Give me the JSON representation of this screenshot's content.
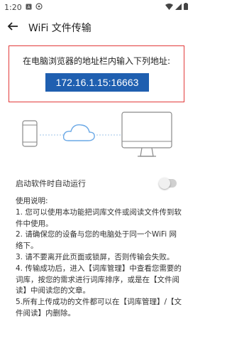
{
  "status_bar": {
    "time": "1:20",
    "left_icons": [
      "sim-a-icon",
      "nfc-icon"
    ],
    "right_icons": [
      "wifi-icon",
      "signal-icon",
      "battery-icon"
    ]
  },
  "app_bar": {
    "title": "WiFi 文件传输"
  },
  "address_panel": {
    "hint": "在电脑浏览器的地址栏内输入下列地址:",
    "address": "172.16.1.15:16663",
    "accent_color": "#e23b3b",
    "highlight_color": "#1f5fb0"
  },
  "settings": {
    "autorun_label": "启动软件时自动运行",
    "autorun_enabled": false
  },
  "instructions": {
    "heading": "使用说明:",
    "items": [
      "1. 您可以使用本功能把词库文件或阅读文件传到软件中使用。",
      "2. 请确保您的设备与您的电脑处于同一个WiFi 网络下。",
      "3. 请不要离开此页面或锁屏，否则传输会失败。",
      "4. 传输成功后，进入【词库管理】中查看您需要的词库，按您的需求进行词库排序，或是在【文件阅读】中阅读您的文章。",
      "5.所有上传成功的文件都可以在【词库管理】/【文件阅读】内删除。"
    ]
  }
}
